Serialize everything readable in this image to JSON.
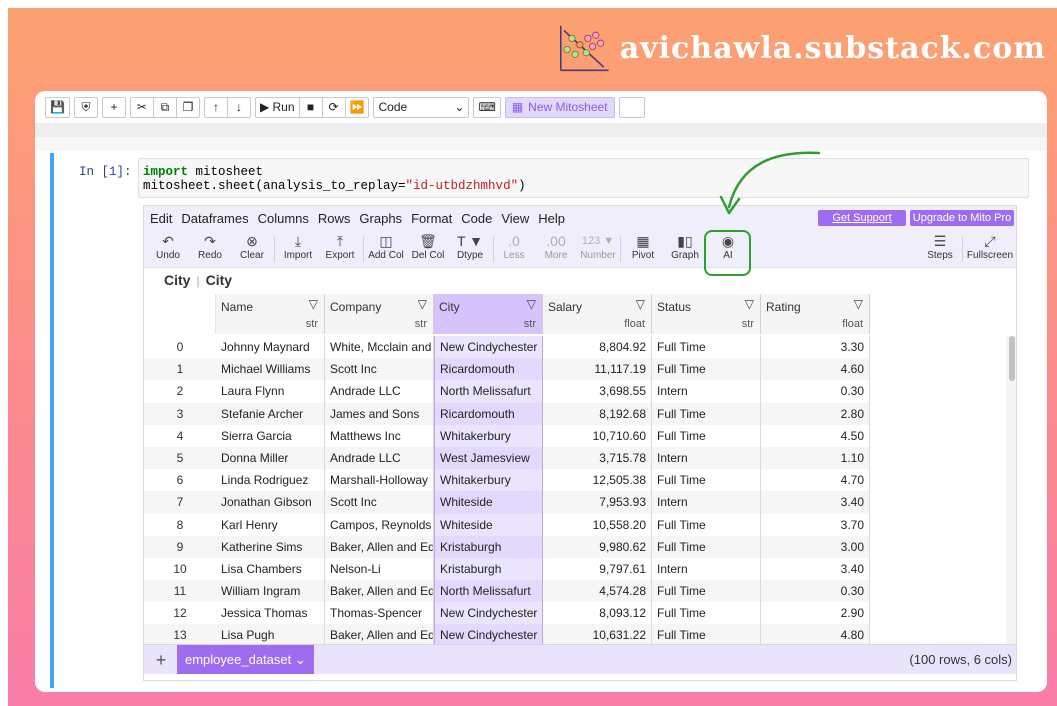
{
  "brand": {
    "text": "avichawla.substack.com"
  },
  "notebook_toolbar": {
    "run_label": "Run",
    "cell_type": "Code",
    "mito_button": "New Mitosheet"
  },
  "cell": {
    "prompt": "In [1]:",
    "code_line1_kw": "import",
    "code_line1_rest": " mitosheet",
    "code_line2_pre": "mitosheet.sheet(analysis_to_replay=",
    "code_line2_str": "\"id-utbdzhmhvd\"",
    "code_line2_post": ")"
  },
  "mito": {
    "menu": [
      "Edit",
      "Dataframes",
      "Columns",
      "Rows",
      "Graphs",
      "Format",
      "Code",
      "View",
      "Help"
    ],
    "get_support": "Get Support",
    "upgrade": "Upgrade to Mito Pro",
    "ribbon": {
      "undo": "Undo",
      "redo": "Redo",
      "clear": "Clear",
      "import": "Import",
      "export": "Export",
      "add_col": "Add Col",
      "del_col": "Del Col",
      "dtype": "Dtype",
      "less": "Less",
      "more": "More",
      "number": "Number",
      "pivot": "Pivot",
      "graph": "Graph",
      "ai": "AI",
      "steps": "Steps",
      "fullscreen": "Fullscreen",
      "less_icon": ".0",
      "more_icon": ".00",
      "number_icon": "123 ▼",
      "dtype_icon": "T ▼"
    },
    "breadcrumb": {
      "left": "City",
      "right": "City"
    },
    "columns": [
      {
        "name": "Name",
        "dtype": "str"
      },
      {
        "name": "Company",
        "dtype": "str"
      },
      {
        "name": "City",
        "dtype": "str"
      },
      {
        "name": "Salary",
        "dtype": "float"
      },
      {
        "name": "Status",
        "dtype": "str"
      },
      {
        "name": "Rating",
        "dtype": "float"
      }
    ],
    "rows": [
      [
        "0",
        "Johnny Maynard",
        "White, Mcclain and Co",
        "New Cindychester",
        "8,804.92",
        "Full Time",
        "3.30"
      ],
      [
        "1",
        "Michael Williams",
        "Scott Inc",
        "Ricardomouth",
        "11,117.19",
        "Full Time",
        "4.60"
      ],
      [
        "2",
        "Laura Flynn",
        "Andrade LLC",
        "North Melissafurt",
        "3,698.55",
        "Intern",
        "0.30"
      ],
      [
        "3",
        "Stefanie Archer",
        "James and Sons",
        "Ricardomouth",
        "8,192.68",
        "Full Time",
        "2.80"
      ],
      [
        "4",
        "Sierra Garcia",
        "Matthews Inc",
        "Whitakerbury",
        "10,710.60",
        "Full Time",
        "4.50"
      ],
      [
        "5",
        "Donna Miller",
        "Andrade LLC",
        "West Jamesview",
        "3,715.78",
        "Intern",
        "1.10"
      ],
      [
        "6",
        "Linda Rodriguez",
        "Marshall-Holloway",
        "Whitakerbury",
        "12,505.38",
        "Full Time",
        "4.70"
      ],
      [
        "7",
        "Jonathan Gibson",
        "Scott Inc",
        "Whiteside",
        "7,953.93",
        "Intern",
        "3.40"
      ],
      [
        "8",
        "Karl Henry",
        "Campos, Reynolds and",
        "Whiteside",
        "10,558.20",
        "Full Time",
        "3.70"
      ],
      [
        "9",
        "Katherine Sims",
        "Baker, Allen and Edwa",
        "Kristaburgh",
        "9,980.62",
        "Full Time",
        "3.00"
      ],
      [
        "10",
        "Lisa Chambers",
        "Nelson-Li",
        "Kristaburgh",
        "9,797.61",
        "Intern",
        "3.40"
      ],
      [
        "11",
        "William Ingram",
        "Baker, Allen and Edwa",
        "North Melissafurt",
        "4,574.28",
        "Full Time",
        "0.30"
      ],
      [
        "12",
        "Jessica Thomas",
        "Thomas-Spencer",
        "New Cindychester",
        "8,093.12",
        "Full Time",
        "2.90"
      ],
      [
        "13",
        "Lisa Pugh",
        "Baker, Allen and Edwa",
        "New Cindychester",
        "10,631.22",
        "Full Time",
        "4.80"
      ]
    ],
    "sheet_tab": "employee_dataset ⌄",
    "rows_info": "(100 rows, 6 cols)"
  },
  "colors": {
    "accent": "#9d6cf0",
    "highlight": "#2f9e2f",
    "cell_marker": "#42a5f5"
  }
}
